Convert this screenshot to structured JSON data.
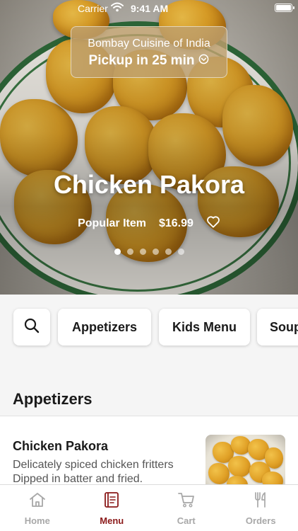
{
  "status_bar": {
    "carrier": "Carrier",
    "time": "9:41 AM"
  },
  "header": {
    "restaurant_name": "Bombay Cuisine of India",
    "pickup_text": "Pickup in 25 min"
  },
  "featured": {
    "title": "Chicken Pakora",
    "tag": "Popular Item",
    "price": "$16.99",
    "carousel_count": 6,
    "carousel_active_index": 0
  },
  "categories": [
    "Appetizers",
    "Kids Menu",
    "Soup"
  ],
  "section": {
    "title": "Appetizers"
  },
  "menu_items": [
    {
      "name": "Chicken Pakora",
      "description": "Delicately spiced chicken fritters Dipped in batter and fried."
    }
  ],
  "tabs": [
    {
      "label": "Home",
      "icon": "home-icon",
      "active": false
    },
    {
      "label": "Menu",
      "icon": "menu-book-icon",
      "active": true
    },
    {
      "label": "Cart",
      "icon": "cart-icon",
      "active": false
    },
    {
      "label": "Orders",
      "icon": "utensils-icon",
      "active": false
    }
  ],
  "colors": {
    "accent": "#8b1a1a",
    "inactive_tab": "#a8a8a8",
    "pickup_card": "#bea06e"
  }
}
